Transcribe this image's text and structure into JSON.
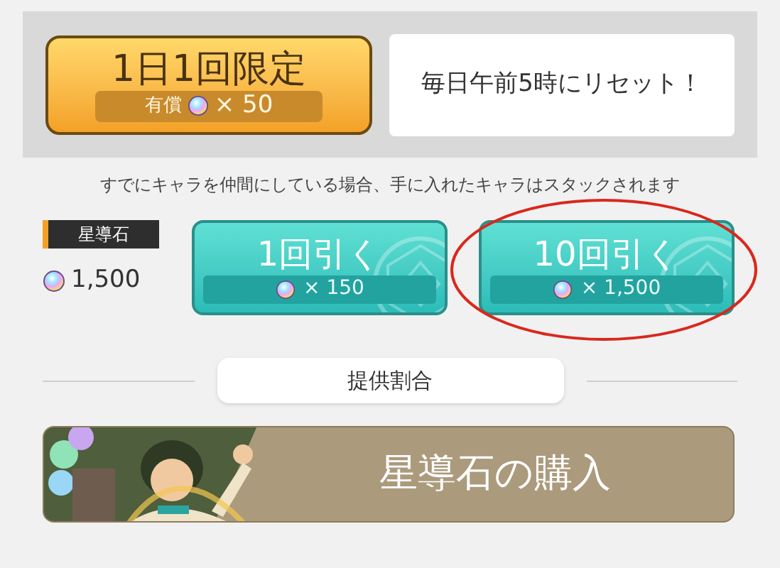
{
  "limited_offer": {
    "title": "1日1回限定",
    "cost_label": "有償",
    "cost": "× 50"
  },
  "speech_bubble": {
    "text": "毎日午前5時にリセット！"
  },
  "notice": "すでにキャラを仲間にしている場合、手に入れたキャラはスタックされます",
  "currency": {
    "label": "星導石",
    "amount": "1,500"
  },
  "draw_buttons": [
    {
      "label": "1回引く",
      "cost": "× 150",
      "circled": false
    },
    {
      "label": "10回引く",
      "cost": "× 1,500",
      "circled": true
    }
  ],
  "rates_button": "提供割合",
  "purchase_banner": {
    "label": "星導石の購入"
  }
}
